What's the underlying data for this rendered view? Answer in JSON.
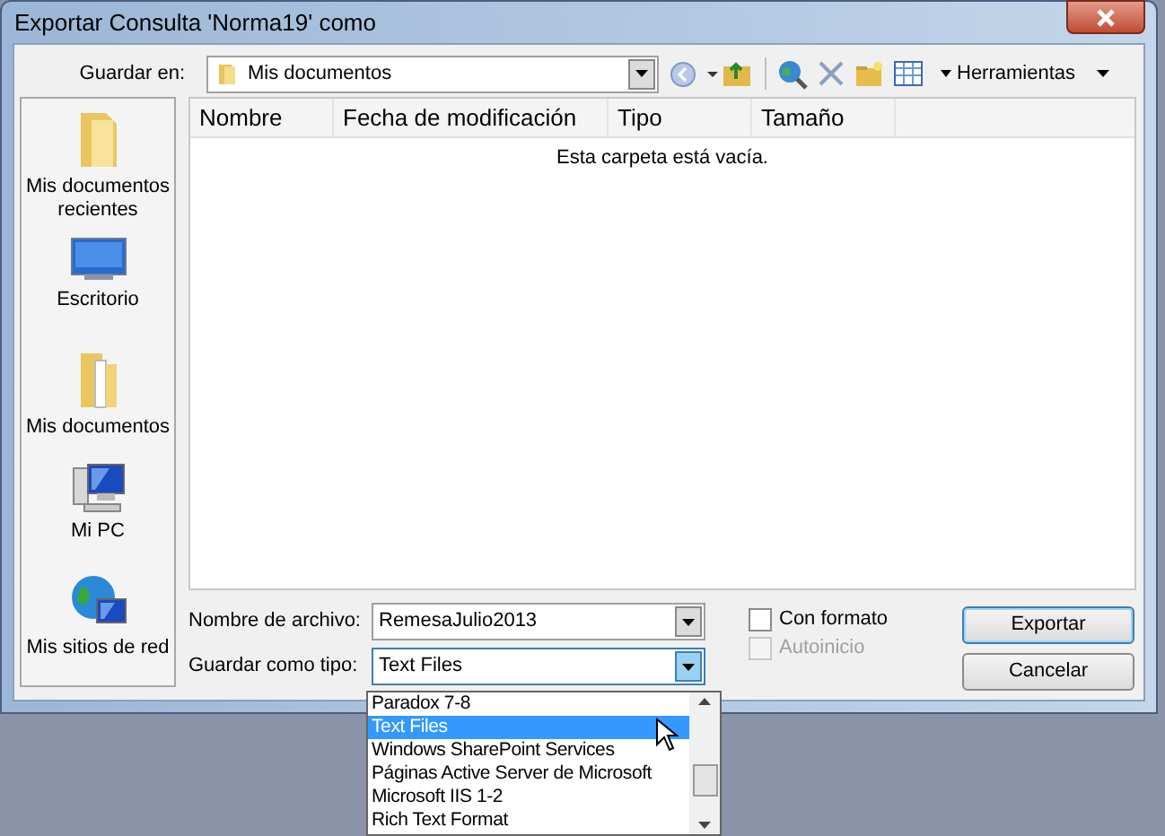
{
  "window": {
    "title": "Exportar Consulta 'Norma19' como"
  },
  "save_in": {
    "label": "Guardar en:",
    "value": "Mis documentos"
  },
  "toolbar": {
    "tools_menu": "Herramientas"
  },
  "places": [
    {
      "kind": "recent",
      "label": "Mis documentos recientes"
    },
    {
      "kind": "desktop",
      "label": "Escritorio"
    },
    {
      "kind": "documents",
      "label": "Mis documentos"
    },
    {
      "kind": "computer",
      "label": "Mi PC"
    },
    {
      "kind": "network",
      "label": "Mis sitios de red"
    }
  ],
  "file_list": {
    "columns": [
      "Nombre",
      "Fecha de modificación",
      "Tipo",
      "Tamaño"
    ],
    "empty_message": "Esta carpeta está vacía."
  },
  "file_name": {
    "label": "Nombre de archivo:",
    "value": "RemesaJulio2013"
  },
  "file_type": {
    "label": "Guardar como tipo:",
    "value": "Text Files",
    "expanded": true,
    "options": [
      {
        "label": "Paradox 7-8",
        "selected": false
      },
      {
        "label": "Text Files",
        "selected": true
      },
      {
        "label": "Windows SharePoint Services",
        "selected": false
      },
      {
        "label": "Páginas Active Server de Microsoft",
        "selected": false
      },
      {
        "label": "Microsoft IIS 1-2",
        "selected": false
      },
      {
        "label": "Rich Text Format",
        "selected": false
      }
    ]
  },
  "options": [
    {
      "label": "Con formato",
      "checked": false,
      "disabled": false
    },
    {
      "label": "Autoinicio",
      "checked": false,
      "disabled": true
    }
  ],
  "buttons": [
    {
      "label": "Exportar",
      "default": true
    },
    {
      "label": "Cancelar",
      "default": false
    }
  ]
}
